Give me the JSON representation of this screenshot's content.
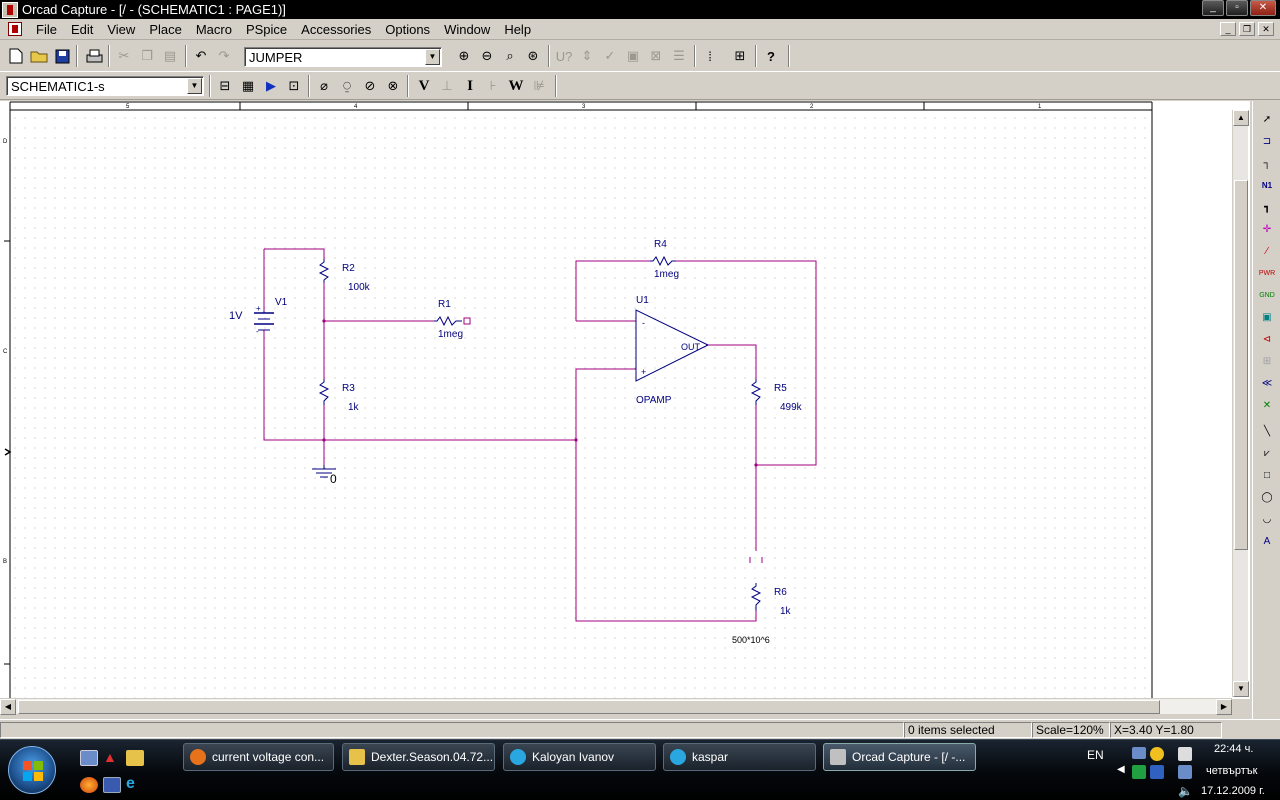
{
  "window": {
    "title": "Orcad Capture - [/ - (SCHEMATIC1 : PAGE1)]",
    "min": "_",
    "max": "▫",
    "close": "✕"
  },
  "menu": [
    "File",
    "Edit",
    "View",
    "Place",
    "Macro",
    "PSpice",
    "Accessories",
    "Options",
    "Window",
    "Help"
  ],
  "toolbar": {
    "part_combo": "JUMPER",
    "schematic_combo": "SCHEMATIC1-s",
    "v_label": "V",
    "i_label": "I",
    "w_label": "W",
    "help": "?"
  },
  "schematic": {
    "border_cols": [
      "5",
      "4",
      "3",
      "2",
      "1"
    ],
    "border_rows": [
      "D",
      "C",
      "B"
    ],
    "parts": {
      "v1_name": "V1",
      "v1_value": "1V",
      "v1_plus": "+",
      "v1_minus": "-",
      "r2_name": "R2",
      "r2_value": "100k",
      "r3_name": "R3",
      "r3_value": "1k",
      "r1_name": "R1",
      "r1_value": "1meg",
      "r4_name": "R4",
      "r4_value": "1meg",
      "u1_name": "U1",
      "u1_type": "OPAMP",
      "u1_out": "OUT",
      "u1_minus": "-",
      "u1_plus": "+",
      "r5_name": "R5",
      "r5_value": "499k",
      "r6_name": "R6",
      "r6_value": "1k",
      "ground": "0",
      "expr": "500*10^6"
    }
  },
  "status": {
    "selection": "0 items selected",
    "scale": "Scale=120%",
    "coords": "X=3.40  Y=1.80"
  },
  "taskbar": {
    "tasks": [
      {
        "label": "current voltage con...",
        "icon_color": "#e8721c"
      },
      {
        "label": "Dexter.Season.04.72...",
        "icon_color": "#e6c24a"
      },
      {
        "label": "Kaloyan Ivanov",
        "icon_color": "#2aa7e0"
      },
      {
        "label": "kaspar",
        "icon_color": "#2aa7e0"
      },
      {
        "label": "Orcad Capture - [/ -...",
        "icon_color": "#c0c0c0"
      }
    ],
    "lang": "EN",
    "time": "22:44 ч.",
    "day": "четвъртък",
    "date": "17.12.2009 г."
  }
}
